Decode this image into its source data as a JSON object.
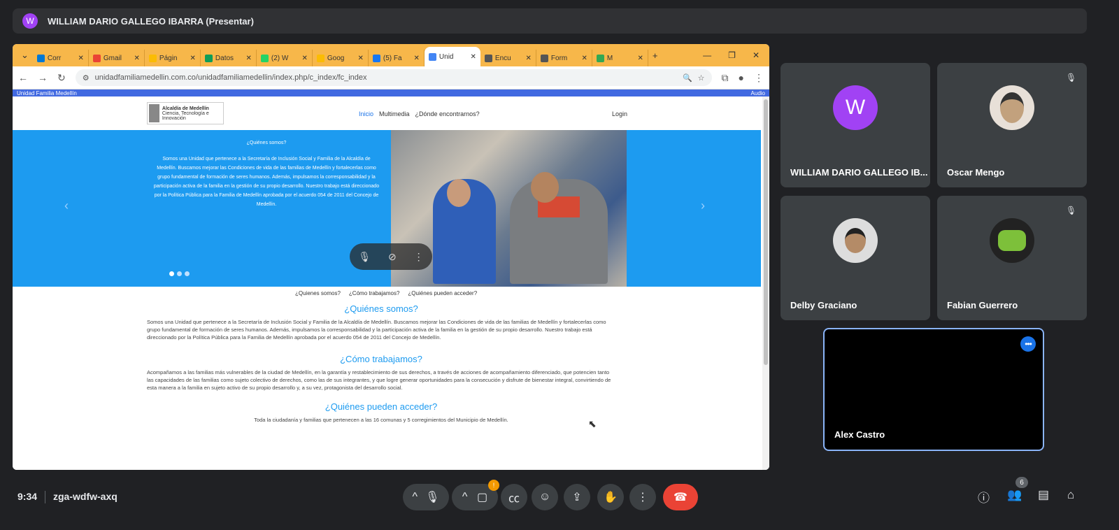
{
  "presenter_bar": {
    "avatar": "W",
    "name": "WILLIAM DARIO GALLEGO IBARRA (Presentar)"
  },
  "browser": {
    "tabs": [
      {
        "label": "Corr",
        "color": "#0078d4"
      },
      {
        "label": "Gmail",
        "color": "#ea4335"
      },
      {
        "label": "Págin",
        "color": "#fbbc04"
      },
      {
        "label": "Datos",
        "color": "#0f9d58"
      },
      {
        "label": "(2) W",
        "color": "#25d366"
      },
      {
        "label": "Goog",
        "color": "#fbbc04"
      },
      {
        "label": "(5) Fa",
        "color": "#1877f2"
      },
      {
        "label": "Unid",
        "color": "#4285f4",
        "active": true
      },
      {
        "label": "Encu",
        "color": "#555555"
      },
      {
        "label": "Form",
        "color": "#555555"
      },
      {
        "label": "M",
        "color": "#34a853"
      }
    ],
    "new_tab": "+",
    "url": "unidadfamiliamedellin.com.co/unidadfamiliamedellin/index.php/c_index/fc_index"
  },
  "site": {
    "topline_left": "Unidad Familia Medellín",
    "topline_right": "Audio",
    "logo_title": "Alcaldía de Medellín",
    "logo_sub": "Ciencia, Tecnología e Innovación",
    "menu": [
      "Inicio",
      "Multimedia",
      "¿Dónde encontrarnos?"
    ],
    "login": "Login",
    "hero_heading": "¿Quiénes somos?",
    "hero_text": "Somos una Unidad que pertenece a la Secretaría de Inclusión Social y Familia de la Alcaldía de Medellín. Buscamos mejorar las Condiciones de vida de las familias de Medellín y fortalecerlas como grupo fundamental de formación de seres humanos. Además, impulsamos la corresponsabilidad y la participación activa de la familia en la gestión de su propio desarrollo. Nuestro trabajo está direccionado por la Política Pública para la Familia de Medellín aprobada por el acuerdo 054 de 2011 del Concejo de Medellín.",
    "sublinks": [
      "¿Quienes somos?",
      "¿Cómo trabajamos?",
      "¿Quiénes pueden acceder?"
    ],
    "section1_title": "¿Quiénes somos?",
    "section1_text": "Somos una Unidad que pertenece a la Secretaría de Inclusión Social y Familia de la Alcaldía de Medellín. Buscamos mejorar las Condiciones de vida de las familias de Medellín y fortalecerlas como grupo fundamental de formación de seres humanos. Además, impulsamos la corresponsabilidad y la participación activa de la familia en la gestión de su propio desarrollo. Nuestro trabajo está direccionado por la Política Pública para la Familia de Medellín aprobada por el acuerdo 054 de 2011 del Concejo de Medellín.",
    "section2_title": "¿Cómo trabajamos?",
    "section2_text": "Acompañamos a las familias más vulnerables de la ciudad de Medellín, en la garantía y restablecimiento de sus derechos, a través de acciones de acompañamiento diferenciado, que potencien tanto las capacidades de las familias como sujeto colectivo de derechos, como las de sus integrantes, y que logre generar oportunidades para la consecución y disfrute de bienestar integral, convirtiendo de esta manera a la familia en sujeto activo de su propio desarrollo y, a su vez, protagonista del desarrollo social.",
    "section3_title": "¿Quiénes pueden acceder?",
    "section3_text": "Toda la ciudadanía y familias que pertenecen a las 16 comunas y 5 corregimientos del Municipio de Medellín."
  },
  "participants": [
    {
      "name": "WILLIAM DARIO GALLEGO IB...",
      "initial": "W"
    },
    {
      "name": "Oscar Mengo"
    },
    {
      "name": "Delby Graciano"
    },
    {
      "name": "Fabian Guerrero"
    },
    {
      "name": "Alex Castro"
    }
  ],
  "bottom": {
    "time": "9:34",
    "meeting_code": "zga-wdfw-axq",
    "participant_count": "6",
    "activity_badge": "!"
  }
}
